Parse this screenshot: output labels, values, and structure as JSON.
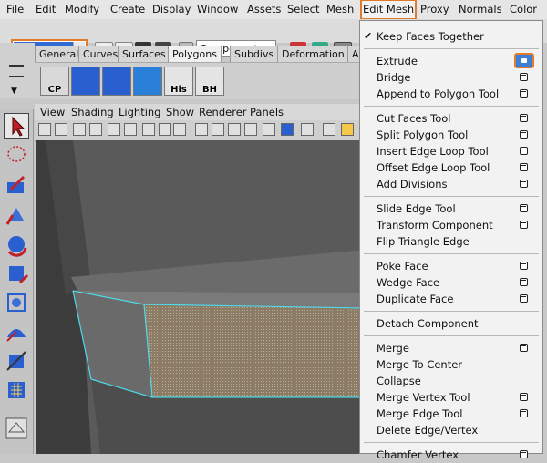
{
  "menubar": {
    "items": [
      "File",
      "Edit",
      "Modify",
      "Create",
      "Display",
      "Window",
      "Assets",
      "Select",
      "Mesh",
      "Edit Mesh",
      "Proxy",
      "Normals",
      "Color"
    ]
  },
  "toolbar": {
    "mode": "Polygons",
    "components_label": "Components"
  },
  "shelf": {
    "tabs": [
      "General",
      "Curves",
      "Surfaces",
      "Polygons",
      "Subdivs",
      "Deformation",
      "Animation"
    ],
    "selected_tab": "Polygons",
    "buttons": [
      "CP",
      "",
      "",
      "",
      "His",
      "BH"
    ]
  },
  "panel_menu": [
    "View",
    "Shading",
    "Lighting",
    "Show",
    "Renderer",
    "Panels"
  ],
  "edit_mesh_menu": {
    "title": "Edit Mesh",
    "groups": [
      [
        {
          "label": "Keep Faces Together",
          "checked": true,
          "option": false
        }
      ],
      [
        {
          "label": "Extrude",
          "option": true,
          "highlight": true
        },
        {
          "label": "Bridge",
          "option": true
        },
        {
          "label": "Append to Polygon Tool",
          "option": true
        }
      ],
      [
        {
          "label": "Cut Faces Tool",
          "option": true
        },
        {
          "label": "Split Polygon Tool",
          "option": true
        },
        {
          "label": "Insert Edge Loop Tool",
          "option": true
        },
        {
          "label": "Offset Edge Loop Tool",
          "option": true
        },
        {
          "label": "Add Divisions",
          "option": true
        }
      ],
      [
        {
          "label": "Slide Edge Tool",
          "option": true
        },
        {
          "label": "Transform Component",
          "option": true
        },
        {
          "label": "Flip Triangle Edge",
          "option": false
        }
      ],
      [
        {
          "label": "Poke Face",
          "option": true
        },
        {
          "label": "Wedge Face",
          "option": true
        },
        {
          "label": "Duplicate Face",
          "option": true
        }
      ],
      [
        {
          "label": "Detach Component",
          "option": false
        }
      ],
      [
        {
          "label": "Merge",
          "option": true
        },
        {
          "label": "Merge To Center",
          "option": false
        },
        {
          "label": "Collapse",
          "option": false
        },
        {
          "label": "Merge Vertex Tool",
          "option": true
        },
        {
          "label": "Merge Edge Tool",
          "option": true
        },
        {
          "label": "Delete Edge/Vertex",
          "option": false
        }
      ],
      [
        {
          "label": "Chamfer Vertex",
          "option": true
        }
      ]
    ]
  },
  "colors": {
    "accent_highlight": "#e07b2a",
    "selection_blue": "#2f6bd0",
    "wire_cyan": "#4fd8e8"
  }
}
